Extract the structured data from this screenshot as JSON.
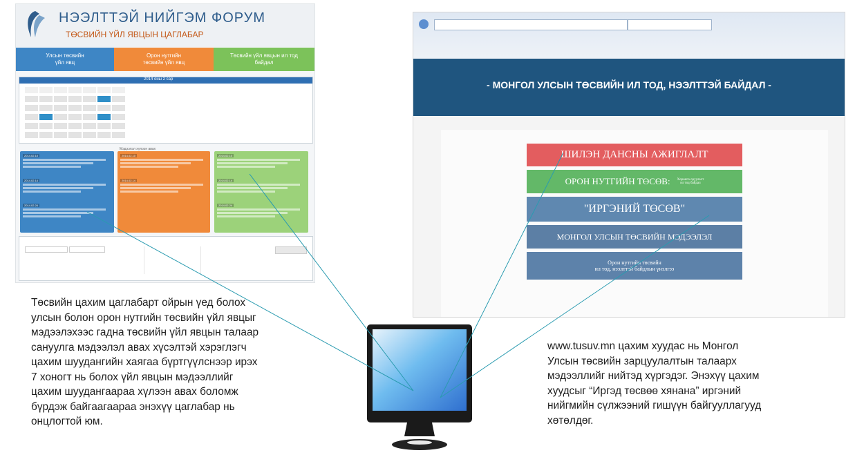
{
  "forum": {
    "title": "НЭЭЛТТЭЙ НИЙГЭМ ФОРУМ",
    "subtitle": "ТӨСВИЙН ҮЙЛ ЯВЦЫН ЦАГЛАБАР",
    "nav": [
      {
        "label": "Улсын төсвийн\nүйл явц",
        "color": "#3e86c5"
      },
      {
        "label": "Орон нутгийн\nтөсвийн үйл явц",
        "color": "#f08a3a"
      },
      {
        "label": "Төсвийн үйл явцын ил тод\nбайдал",
        "color": "#7cc25a"
      }
    ],
    "calendar_month": "2014 оны 2 сар",
    "list_title": "Мэдээлэл хүлээн авах",
    "columns": [
      {
        "color": "#3e86c5",
        "items": [
          "2014.02.10",
          "2014.02.14",
          "2014.02.24"
        ]
      },
      {
        "color": "#f08a3a",
        "items": [
          "2014.02.10",
          "2014.02.14"
        ]
      },
      {
        "color": "#9cd27a",
        "items": [
          "2014.02.10",
          "2014.02.14",
          "2014.02.24"
        ]
      }
    ]
  },
  "site": {
    "title": "- МОНГОЛ УЛСЫН ТӨСВИЙН ИЛ ТОД, НЭЭЛТТЭЙ БАЙДАЛ -",
    "buttons": [
      {
        "label": "ШИЛЭН ДАНСНЫ АЖИГЛАЛТ",
        "color": "#e35d5f"
      },
      {
        "label": "ОРОН НУТГИЙН ТӨСӨВ:",
        "sub": "Хөрөнгө оруулалт\nил тод байдал",
        "color": "#63b868"
      },
      {
        "label": "\"ИРГЭНИЙ ТӨСӨВ\"",
        "color": "#5f88b0"
      },
      {
        "label": "МОНГОЛ УЛСЫН ТӨСВИЙН МЭДЭЭЛЭЛ",
        "color": "#5c7fa5"
      },
      {
        "label": "Орон нутгийн төсвийн\nил тод, нээлттэй байдлын үнэлгээ",
        "color": "#5d82aa",
        "small": true
      }
    ]
  },
  "captions": {
    "left": [
      "Төсвийн цахим цаглабарт ойрын үед болох",
      "улсын болон орон нутгийн төсвийн үйл явцыг",
      "мэдээлэхээс гадна төсвийн үйл явцын талаар",
      "сануулга мэдээлэл авах хүсэлтэй хэрэглэгч",
      "цахим шуудангийн хаягаа бүртгүүлснээр ирэх",
      "7 хоногт нь болох үйл явцын мэдээллийг",
      "цахим шуудангаараа хүлээн авах боломж",
      "бүрдэж байгаагаараа энэхүү цаглабар нь",
      "онцлогтой юм."
    ],
    "right": [
      "www.tusuv.mn цахим хуудас нь Монгол",
      "Улсын төсвийн зарцуулалтын талаарх",
      "мэдээллийг нийтэд хүргэдэг. Энэхүү цахим",
      "хуудсыг “Иргэд төсвөө хянана” иргэний",
      "нийгмийн сүлжээний гишүүн байгууллагууд",
      "хөтөлдөг."
    ]
  },
  "colors": {
    "line": "#2a9bb0",
    "monitor_screen": "#4aa8e8"
  }
}
